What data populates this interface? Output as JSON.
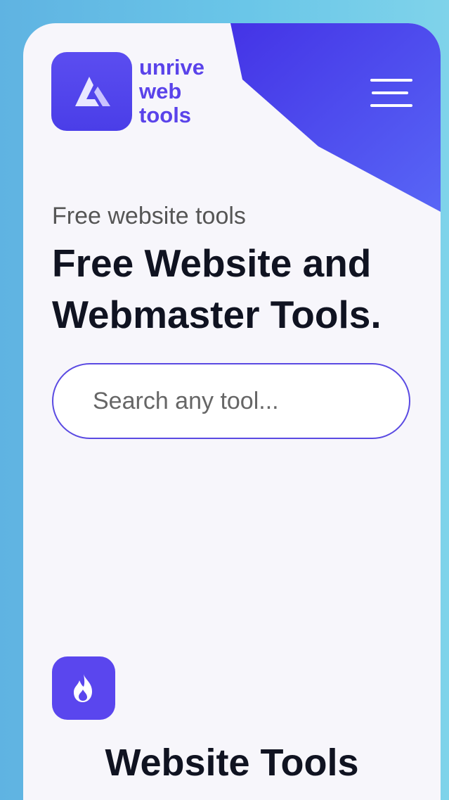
{
  "brand": {
    "name_lines": [
      "unrive",
      "web",
      "tools"
    ],
    "logo_icon": "triangle-logo-icon",
    "color": "#5a43ea"
  },
  "header": {
    "menu_icon": "hamburger-menu-icon",
    "accent": "#4b3ef0"
  },
  "hero": {
    "eyebrow": "Free website tools",
    "headline": "Free Website and Webmaster Tools."
  },
  "search": {
    "placeholder": "Search any tool..."
  },
  "section": {
    "icon": "fire-icon",
    "title": "Website Tools"
  }
}
